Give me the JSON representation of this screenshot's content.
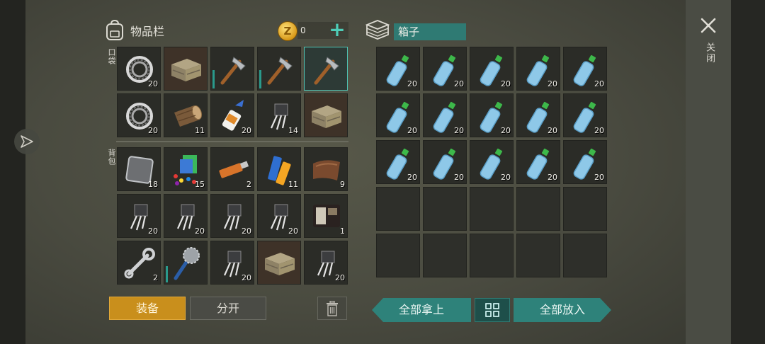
{
  "header": {
    "inventory_title": "物品栏",
    "coin_count": "0",
    "box_title": "箱子",
    "close_label": "关闭"
  },
  "sections": {
    "pocket": "口袋",
    "backpack": "背包"
  },
  "pocket_slots": [
    {
      "item": "bearing",
      "qty": "20"
    },
    {
      "item": "wooden-crate",
      "qty": ""
    },
    {
      "item": "hatchet",
      "qty": "",
      "durability": 0.45
    },
    {
      "item": "hatchet",
      "qty": "",
      "durability": 0.45
    },
    {
      "item": "hatchet",
      "qty": "",
      "selected": true
    },
    {
      "item": "bearing",
      "qty": "20"
    },
    {
      "item": "log",
      "qty": "11"
    },
    {
      "item": "glue",
      "qty": "20"
    },
    {
      "item": "transistor",
      "qty": "14"
    },
    {
      "item": "wooden-crate",
      "qty": ""
    }
  ],
  "backpack_slots": [
    {
      "item": "metal-plate",
      "qty": "18"
    },
    {
      "item": "circuit-parts",
      "qty": "15"
    },
    {
      "item": "usb-drive",
      "qty": "2"
    },
    {
      "item": "batteries",
      "qty": "11"
    },
    {
      "item": "leather",
      "qty": "9"
    },
    {
      "item": "transistor",
      "qty": "20"
    },
    {
      "item": "transistor",
      "qty": "20"
    },
    {
      "item": "transistor",
      "qty": "20"
    },
    {
      "item": "transistor",
      "qty": "20"
    },
    {
      "item": "wallet",
      "qty": "1"
    },
    {
      "item": "wrench",
      "qty": "2"
    },
    {
      "item": "saw-mace",
      "qty": "",
      "durability": 0.4
    },
    {
      "item": "transistor",
      "qty": "20"
    },
    {
      "item": "wooden-crate",
      "qty": ""
    },
    {
      "item": "transistor",
      "qty": "20"
    }
  ],
  "box_slots": [
    {
      "item": "water-bottle",
      "qty": "20"
    },
    {
      "item": "water-bottle",
      "qty": "20"
    },
    {
      "item": "water-bottle",
      "qty": "20"
    },
    {
      "item": "water-bottle",
      "qty": "20"
    },
    {
      "item": "water-bottle",
      "qty": "20"
    },
    {
      "item": "water-bottle",
      "qty": "20"
    },
    {
      "item": "water-bottle",
      "qty": "20"
    },
    {
      "item": "water-bottle",
      "qty": "20"
    },
    {
      "item": "water-bottle",
      "qty": "20"
    },
    {
      "item": "water-bottle",
      "qty": "20"
    },
    {
      "item": "water-bottle",
      "qty": "20"
    },
    {
      "item": "water-bottle",
      "qty": "20"
    },
    {
      "item": "water-bottle",
      "qty": "20"
    },
    {
      "item": "water-bottle",
      "qty": "20"
    },
    {
      "item": "water-bottle",
      "qty": "20"
    },
    {
      "item": "",
      "qty": ""
    },
    {
      "item": "",
      "qty": ""
    },
    {
      "item": "",
      "qty": ""
    },
    {
      "item": "",
      "qty": ""
    },
    {
      "item": "",
      "qty": ""
    },
    {
      "item": "",
      "qty": ""
    },
    {
      "item": "",
      "qty": ""
    },
    {
      "item": "",
      "qty": ""
    },
    {
      "item": "",
      "qty": ""
    },
    {
      "item": "",
      "qty": ""
    }
  ],
  "buttons": {
    "equip": "装备",
    "split": "分开",
    "take_all": "全部拿上",
    "put_all": "全部放入"
  },
  "colors": {
    "accent_teal": "#2e827a",
    "equip_gold": "#c98f1c",
    "plus_green": "#4ecdb8"
  }
}
